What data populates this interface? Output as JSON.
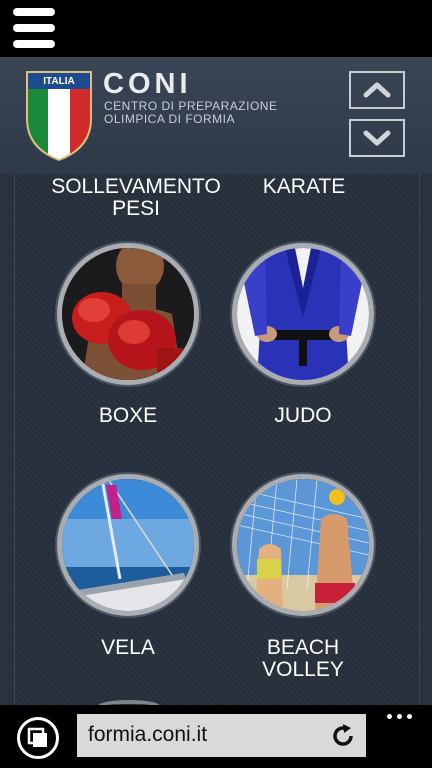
{
  "header": {
    "logo_text": "ITALIA",
    "title": "CONI",
    "subtitle_line1": "Centro di Preparazione",
    "subtitle_line2": "Olimpica di Formia"
  },
  "sports": [
    {
      "label": "SOLLEVAMENTO PESI",
      "line1": "SOLLEVAMENTO",
      "line2": "PESI"
    },
    {
      "label": "KARATE",
      "line1": "KARATE",
      "line2": ""
    },
    {
      "label": "BOXE",
      "line1": "BOXE",
      "line2": ""
    },
    {
      "label": "JUDO",
      "line1": "JUDO",
      "line2": ""
    },
    {
      "label": "VELA",
      "line1": "VELA",
      "line2": ""
    },
    {
      "label": "BEACH VOLLEY",
      "line1": "BEACH",
      "line2": "VOLLEY"
    }
  ],
  "browser": {
    "url": "formia.coni.it"
  },
  "icons": {
    "menu": "hamburger-menu-icon",
    "up": "chevron-up-icon",
    "down": "chevron-down-icon",
    "tabs": "tabs-icon",
    "refresh": "refresh-icon",
    "more": "more-icon"
  },
  "colors": {
    "header_bg": "#333f4f",
    "content_bg": "#26303c",
    "ring": "#a9adb2",
    "url_bar": "#d9d9d9"
  }
}
